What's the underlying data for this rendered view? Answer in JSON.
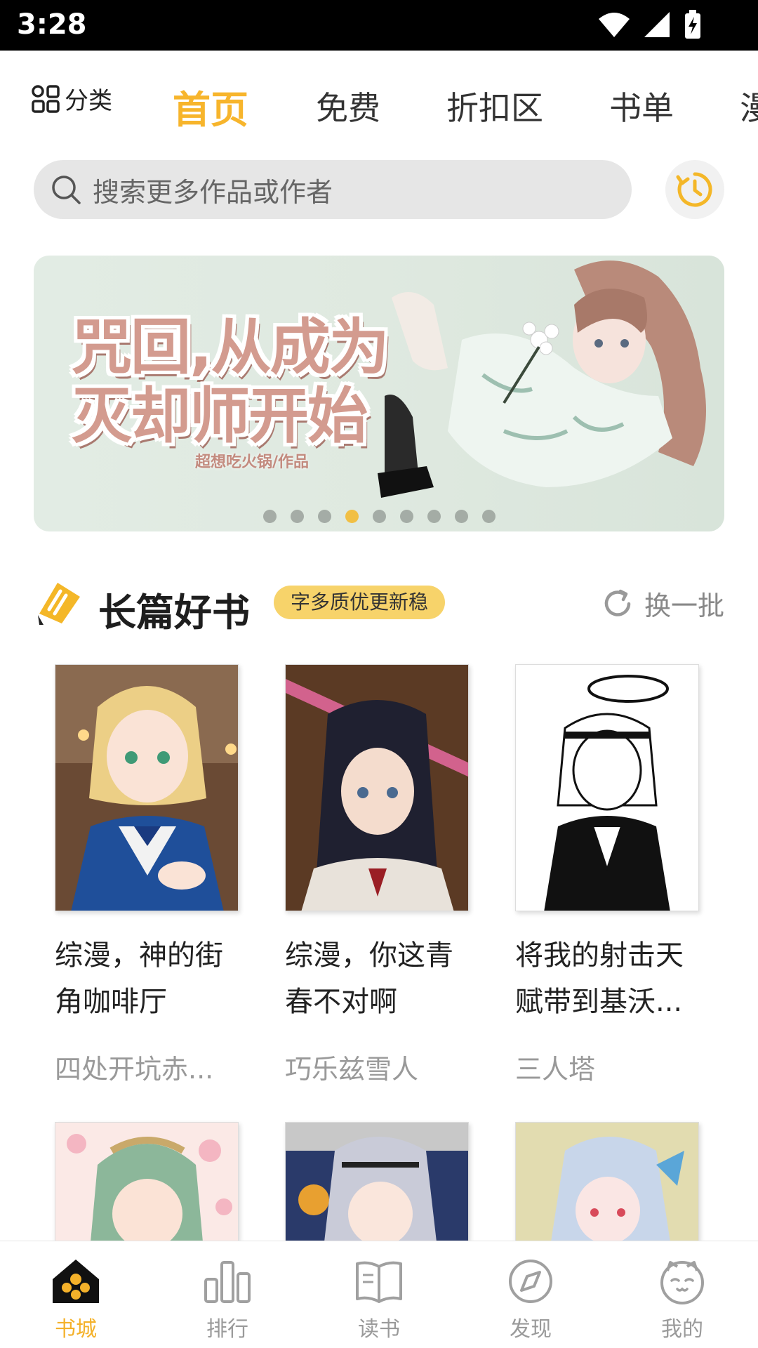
{
  "status_bar": {
    "time": "3:28"
  },
  "top_nav": {
    "category_label": "分类",
    "tabs": [
      {
        "label": "首页",
        "active": true
      },
      {
        "label": "免费"
      },
      {
        "label": "折扣区"
      },
      {
        "label": "书单"
      },
      {
        "label": "漫"
      }
    ]
  },
  "search": {
    "placeholder": "搜索更多作品或作者"
  },
  "banner": {
    "title_line1": "咒回,从成为",
    "title_line2": "灭却师开始",
    "byline": "超想吃火锅/作品",
    "dot_count": 9,
    "active_dot": 3
  },
  "section": {
    "title": "长篇好书",
    "tag": "字多质优更新稳",
    "refresh_label": "换一批"
  },
  "books": [
    {
      "name": "综漫，神的街角咖啡厅",
      "author": "四处开坑赤..."
    },
    {
      "name": "综漫，你这青春不对啊",
      "author": "巧乐兹雪人"
    },
    {
      "name": "将我的射击天赋带到基沃...",
      "author": "三人塔"
    }
  ],
  "bottom_nav": [
    {
      "label": "书城",
      "icon": "bookstore-home-icon",
      "active": true
    },
    {
      "label": "排行",
      "icon": "ranking-bars-icon"
    },
    {
      "label": "读书",
      "icon": "open-book-icon"
    },
    {
      "label": "发现",
      "icon": "compass-icon"
    },
    {
      "label": "我的",
      "icon": "cat-face-icon"
    }
  ],
  "colors": {
    "accent": "#f7b52c",
    "tag_bg": "#f7d36a",
    "status_bar": "#000000"
  }
}
